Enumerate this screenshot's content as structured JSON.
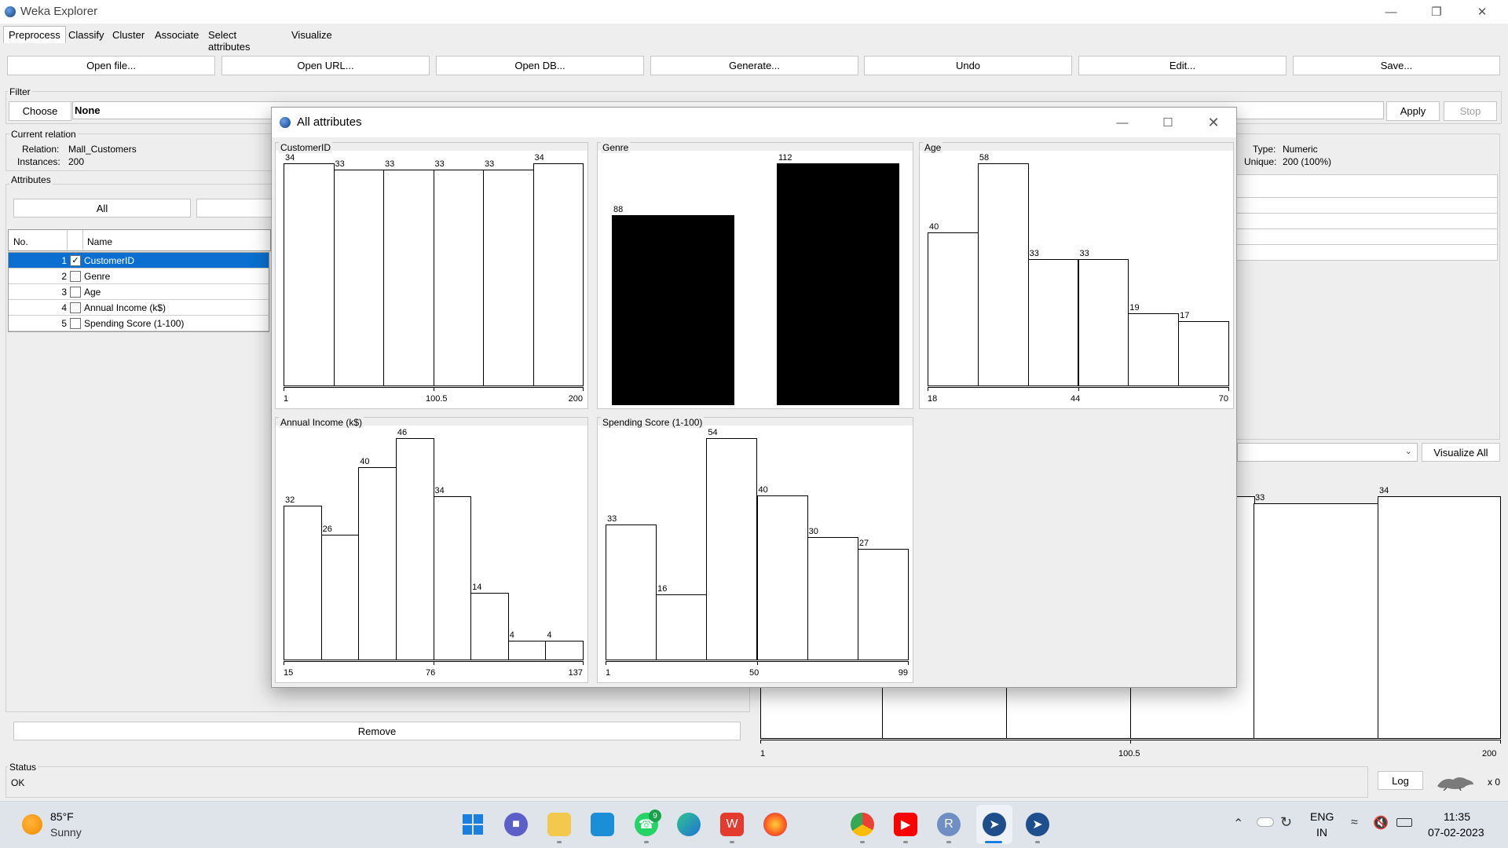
{
  "window": {
    "title": "Weka Explorer"
  },
  "tabs": [
    "Preprocess",
    "Classify",
    "Cluster",
    "Associate",
    "Select attributes",
    "Visualize"
  ],
  "toolbar": [
    "Open file...",
    "Open URL...",
    "Open DB...",
    "Generate...",
    "Undo",
    "Edit...",
    "Save..."
  ],
  "filter": {
    "label": "Filter",
    "choose": "Choose",
    "value": "None",
    "apply": "Apply",
    "stop": "Stop"
  },
  "relation": {
    "label": "Current relation",
    "relation_key": "Relation:",
    "relation_val": "Mall_Customers",
    "instances_key": "Instances:",
    "instances_val": "200"
  },
  "selected": {
    "type_key": "Type:",
    "type_val": "Numeric",
    "unique_key": "Unique:",
    "unique_val": "200 (100%)"
  },
  "attributes": {
    "label": "Attributes",
    "all_button": "All",
    "col_no": "No.",
    "col_name": "Name",
    "rows": [
      {
        "no": "1",
        "name": "CustomerID",
        "checked": "✓"
      },
      {
        "no": "2",
        "name": "Genre",
        "checked": ""
      },
      {
        "no": "3",
        "name": "Age",
        "checked": ""
      },
      {
        "no": "4",
        "name": "Annual Income (k$)",
        "checked": ""
      },
      {
        "no": "5",
        "name": "Spending Score (1-100)",
        "checked": ""
      }
    ],
    "remove": "Remove"
  },
  "visualize_all": "Visualize All",
  "main_histogram": {
    "counts": [
      "33",
      "34"
    ],
    "ticks": [
      "1",
      "100.5",
      "200"
    ]
  },
  "status": {
    "label": "Status",
    "text": "OK",
    "log": "Log",
    "count": "x 0"
  },
  "popup": {
    "title": "All attributes"
  },
  "chart_data": [
    {
      "type": "bar",
      "title": "CustomerID",
      "categories": [
        "b1",
        "b2",
        "b3",
        "b4",
        "b5",
        "b6"
      ],
      "values": [
        34,
        33,
        33,
        33,
        33,
        34
      ],
      "ticks": [
        "1",
        "100.5",
        "200"
      ],
      "ylim": [
        0,
        34
      ]
    },
    {
      "type": "bar",
      "title": "Genre",
      "categories": [
        "c1",
        "c2"
      ],
      "values": [
        88,
        112
      ],
      "ylim": [
        0,
        112
      ]
    },
    {
      "type": "bar",
      "title": "Age",
      "categories": [
        "b1",
        "b2",
        "b3",
        "b4",
        "b5",
        "b6"
      ],
      "values": [
        40,
        58,
        33,
        33,
        19,
        17
      ],
      "ticks": [
        "18",
        "44",
        "70"
      ],
      "ylim": [
        0,
        58
      ]
    },
    {
      "type": "bar",
      "title": "Annual Income (k$)",
      "categories": [
        "b1",
        "b2",
        "b3",
        "b4",
        "b5",
        "b6",
        "b7",
        "b8"
      ],
      "values": [
        32,
        26,
        40,
        46,
        34,
        14,
        4,
        4
      ],
      "ticks": [
        "15",
        "76",
        "137"
      ],
      "ylim": [
        0,
        46
      ]
    },
    {
      "type": "bar",
      "title": "Spending Score (1-100)",
      "categories": [
        "b1",
        "b2",
        "b3",
        "b4",
        "b5",
        "b6"
      ],
      "values": [
        33,
        16,
        54,
        40,
        30,
        27
      ],
      "ticks": [
        "1",
        "50",
        "99"
      ],
      "ylim": [
        0,
        54
      ]
    }
  ],
  "taskbar": {
    "weather_temp": "85°F",
    "weather_desc": "Sunny",
    "lang1": "ENG",
    "lang2": "IN",
    "time": "11:35",
    "date": "07-02-2023",
    "whatsapp_badge": "9"
  }
}
